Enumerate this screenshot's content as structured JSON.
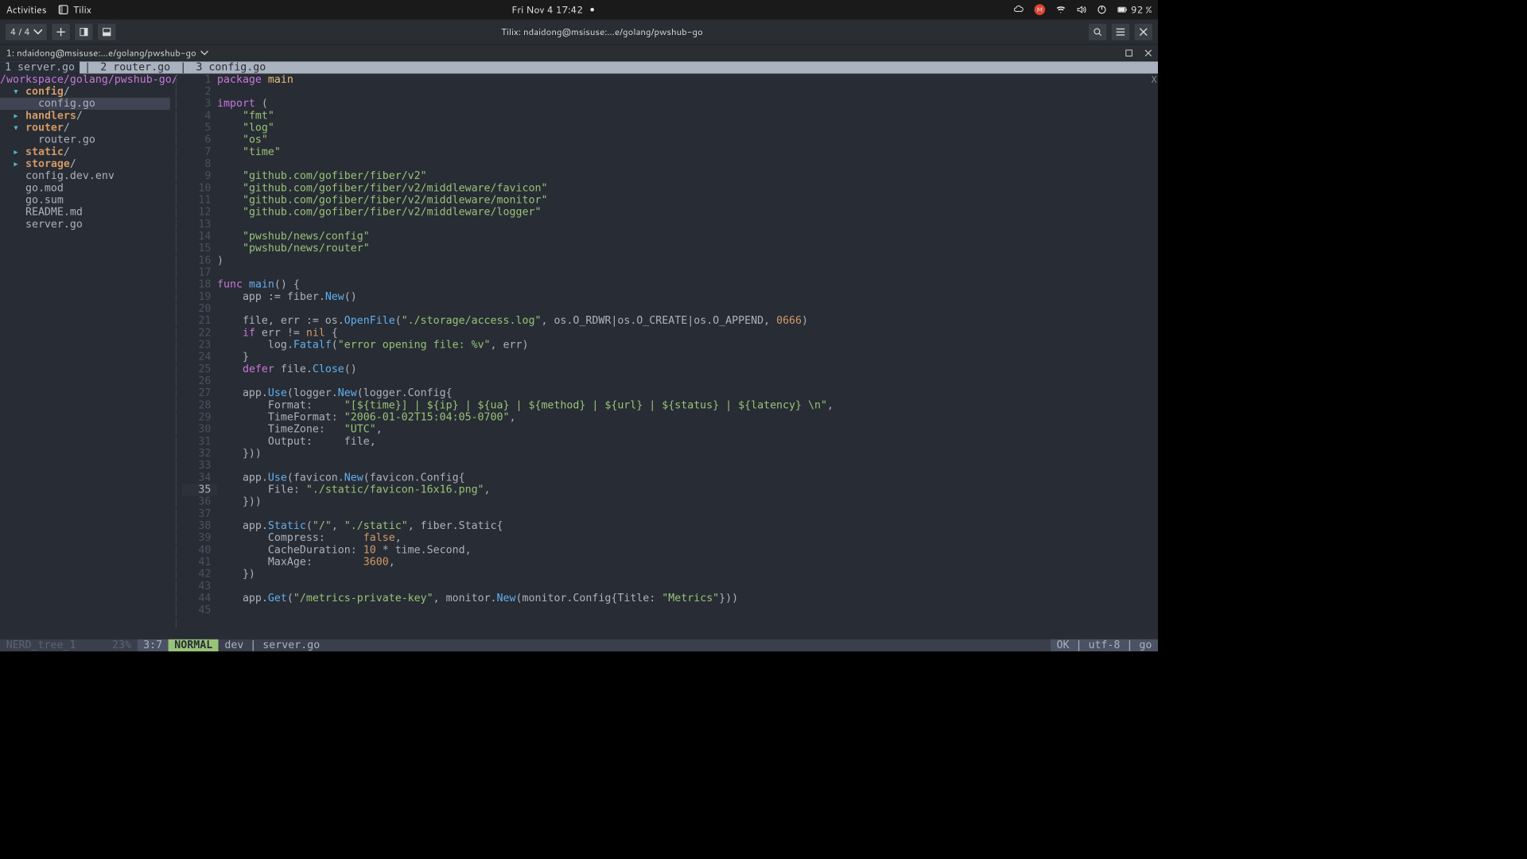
{
  "gnome": {
    "activities": "Activities",
    "app_name": "Tilix",
    "clock": "Fri Nov 4  17:42",
    "battery": "92 %"
  },
  "tilix": {
    "session_counter": "4 / 4",
    "title": "Tilix: ndaidong@msisuse:…e/golang/pwshub-go",
    "tab_label": "1: ndaidong@msisuse:…e/golang/pwshub-go"
  },
  "vim": {
    "tabs": [
      {
        "label": "1 server.go",
        "active": true
      },
      {
        "label": "2 router.go",
        "active": false
      },
      {
        "label": "3 config.go",
        "active": false
      }
    ],
    "tabs_close": "X",
    "nerdtree": {
      "root": "/workspace/golang/pwshub-go/",
      "items": [
        {
          "type": "dir",
          "name": "config",
          "open": true,
          "depth": 0
        },
        {
          "type": "file",
          "name": "config.go",
          "depth": 1,
          "selected": true
        },
        {
          "type": "dir",
          "name": "handlers",
          "open": false,
          "depth": 0
        },
        {
          "type": "dir",
          "name": "router",
          "open": true,
          "depth": 0
        },
        {
          "type": "file",
          "name": "router.go",
          "depth": 1
        },
        {
          "type": "dir",
          "name": "static",
          "open": false,
          "depth": 0
        },
        {
          "type": "dir",
          "name": "storage",
          "open": false,
          "depth": 0
        },
        {
          "type": "file",
          "name": "config.dev.env",
          "depth": 0
        },
        {
          "type": "file",
          "name": "go.mod",
          "depth": 0
        },
        {
          "type": "file",
          "name": "go.sum",
          "depth": 0
        },
        {
          "type": "file",
          "name": "README.md",
          "depth": 0
        },
        {
          "type": "file",
          "name": "server.go",
          "depth": 0
        }
      ]
    },
    "code_lines": [
      {
        "n": 1,
        "seg": [
          [
            "kw",
            "package"
          ],
          [
            "plain",
            " "
          ],
          [
            "ident",
            "main"
          ]
        ]
      },
      {
        "n": 2,
        "seg": []
      },
      {
        "n": 3,
        "seg": [
          [
            "kw",
            "import"
          ],
          [
            "plain",
            " ("
          ]
        ]
      },
      {
        "n": 4,
        "seg": [
          [
            "plain",
            "    "
          ],
          [
            "str",
            "\"fmt\""
          ]
        ]
      },
      {
        "n": 5,
        "seg": [
          [
            "plain",
            "    "
          ],
          [
            "str",
            "\"log\""
          ]
        ]
      },
      {
        "n": 6,
        "seg": [
          [
            "plain",
            "    "
          ],
          [
            "str",
            "\"os\""
          ]
        ]
      },
      {
        "n": 7,
        "seg": [
          [
            "plain",
            "    "
          ],
          [
            "str",
            "\"time\""
          ]
        ]
      },
      {
        "n": 8,
        "seg": []
      },
      {
        "n": 9,
        "seg": [
          [
            "plain",
            "    "
          ],
          [
            "str",
            "\"github.com/gofiber/fiber/v2\""
          ]
        ]
      },
      {
        "n": 10,
        "seg": [
          [
            "plain",
            "    "
          ],
          [
            "str",
            "\"github.com/gofiber/fiber/v2/middleware/favicon\""
          ]
        ]
      },
      {
        "n": 11,
        "seg": [
          [
            "plain",
            "    "
          ],
          [
            "str",
            "\"github.com/gofiber/fiber/v2/middleware/monitor\""
          ]
        ]
      },
      {
        "n": 12,
        "seg": [
          [
            "plain",
            "    "
          ],
          [
            "str",
            "\"github.com/gofiber/fiber/v2/middleware/logger\""
          ]
        ]
      },
      {
        "n": 13,
        "seg": []
      },
      {
        "n": 14,
        "seg": [
          [
            "plain",
            "    "
          ],
          [
            "str",
            "\"pwshub/news/config\""
          ]
        ]
      },
      {
        "n": 15,
        "seg": [
          [
            "plain",
            "    "
          ],
          [
            "str",
            "\"pwshub/news/router\""
          ]
        ]
      },
      {
        "n": 16,
        "seg": [
          [
            "plain",
            ")"
          ]
        ]
      },
      {
        "n": 17,
        "seg": []
      },
      {
        "n": 18,
        "seg": [
          [
            "kw",
            "func"
          ],
          [
            "plain",
            " "
          ],
          [
            "fn",
            "main"
          ],
          [
            "plain",
            "() {"
          ]
        ]
      },
      {
        "n": 19,
        "seg": [
          [
            "plain",
            "    app := fiber."
          ],
          [
            "fn",
            "New"
          ],
          [
            "plain",
            "()"
          ]
        ]
      },
      {
        "n": 20,
        "seg": []
      },
      {
        "n": 21,
        "seg": [
          [
            "plain",
            "    file, err := os."
          ],
          [
            "fn",
            "OpenFile"
          ],
          [
            "plain",
            "("
          ],
          [
            "str",
            "\"./storage/access.log\""
          ],
          [
            "plain",
            ", os.O_RDWR|os.O_CREATE|os.O_APPEND, "
          ],
          [
            "num",
            "0666"
          ],
          [
            "plain",
            ")"
          ]
        ]
      },
      {
        "n": 22,
        "seg": [
          [
            "plain",
            "    "
          ],
          [
            "kw",
            "if"
          ],
          [
            "plain",
            " err != "
          ],
          [
            "const",
            "nil"
          ],
          [
            "plain",
            " {"
          ]
        ]
      },
      {
        "n": 23,
        "seg": [
          [
            "plain",
            "        log."
          ],
          [
            "fn",
            "Fatalf"
          ],
          [
            "plain",
            "("
          ],
          [
            "str",
            "\"error opening file: %v\""
          ],
          [
            "plain",
            ", err)"
          ]
        ]
      },
      {
        "n": 24,
        "seg": [
          [
            "plain",
            "    }"
          ]
        ]
      },
      {
        "n": 25,
        "seg": [
          [
            "plain",
            "    "
          ],
          [
            "kw",
            "defer"
          ],
          [
            "plain",
            " file."
          ],
          [
            "fn",
            "Close"
          ],
          [
            "plain",
            "()"
          ]
        ]
      },
      {
        "n": 26,
        "seg": []
      },
      {
        "n": 27,
        "seg": [
          [
            "plain",
            "    app."
          ],
          [
            "fn",
            "Use"
          ],
          [
            "plain",
            "(logger."
          ],
          [
            "fn",
            "New"
          ],
          [
            "plain",
            "(logger.Config{"
          ]
        ]
      },
      {
        "n": 28,
        "seg": [
          [
            "plain",
            "        Format:     "
          ],
          [
            "str",
            "\"[${time}] | ${ip} | ${ua} | ${method} | ${url} | ${status} | ${latency} \\n\""
          ],
          [
            "plain",
            ","
          ]
        ]
      },
      {
        "n": 29,
        "seg": [
          [
            "plain",
            "        TimeFormat: "
          ],
          [
            "str",
            "\"2006-01-02T15:04:05-0700\""
          ],
          [
            "plain",
            ","
          ]
        ]
      },
      {
        "n": 30,
        "seg": [
          [
            "plain",
            "        TimeZone:   "
          ],
          [
            "str",
            "\"UTC\""
          ],
          [
            "plain",
            ","
          ]
        ]
      },
      {
        "n": 31,
        "seg": [
          [
            "plain",
            "        Output:     file,"
          ]
        ]
      },
      {
        "n": 32,
        "seg": [
          [
            "plain",
            "    }))"
          ]
        ]
      },
      {
        "n": 33,
        "seg": []
      },
      {
        "n": 34,
        "seg": [
          [
            "plain",
            "    app."
          ],
          [
            "fn",
            "Use"
          ],
          [
            "plain",
            "(favicon."
          ],
          [
            "fn",
            "New"
          ],
          [
            "plain",
            "(favicon.Config{"
          ]
        ]
      },
      {
        "n": 35,
        "seg": [
          [
            "plain",
            "        File: "
          ],
          [
            "str",
            "\"./static/favicon-16x16.png\""
          ],
          [
            "plain",
            ","
          ]
        ],
        "cur": true
      },
      {
        "n": 36,
        "seg": [
          [
            "plain",
            "    }))"
          ]
        ]
      },
      {
        "n": 37,
        "seg": []
      },
      {
        "n": 38,
        "seg": [
          [
            "plain",
            "    app."
          ],
          [
            "fn",
            "Static"
          ],
          [
            "plain",
            "("
          ],
          [
            "str",
            "\"/\""
          ],
          [
            "plain",
            ", "
          ],
          [
            "str",
            "\"./static\""
          ],
          [
            "plain",
            ", fiber.Static{"
          ]
        ]
      },
      {
        "n": 39,
        "seg": [
          [
            "plain",
            "        Compress:      "
          ],
          [
            "const",
            "false"
          ],
          [
            "plain",
            ","
          ]
        ]
      },
      {
        "n": 40,
        "seg": [
          [
            "plain",
            "        CacheDuration: "
          ],
          [
            "num",
            "10"
          ],
          [
            "plain",
            " * time.Second,"
          ]
        ]
      },
      {
        "n": 41,
        "seg": [
          [
            "plain",
            "        MaxAge:        "
          ],
          [
            "num",
            "3600"
          ],
          [
            "plain",
            ","
          ]
        ]
      },
      {
        "n": 42,
        "seg": [
          [
            "plain",
            "    })"
          ]
        ]
      },
      {
        "n": 43,
        "seg": []
      },
      {
        "n": 44,
        "seg": [
          [
            "plain",
            "    app."
          ],
          [
            "fn",
            "Get"
          ],
          [
            "plain",
            "("
          ],
          [
            "str",
            "\"/metrics-private-key\""
          ],
          [
            "plain",
            ", monitor."
          ],
          [
            "fn",
            "New"
          ],
          [
            "plain",
            "(monitor.Config{Title: "
          ],
          [
            "str",
            "\"Metrics\""
          ],
          [
            "plain",
            "}))"
          ]
        ]
      },
      {
        "n": 45,
        "seg": []
      }
    ],
    "status": {
      "left1": "NERD_tree_1",
      "percent": "23%",
      "pos": "3:7",
      "mode": "NORMAL",
      "branch": "dev",
      "file": "server.go",
      "right": "OK | utf-8 | go"
    }
  }
}
